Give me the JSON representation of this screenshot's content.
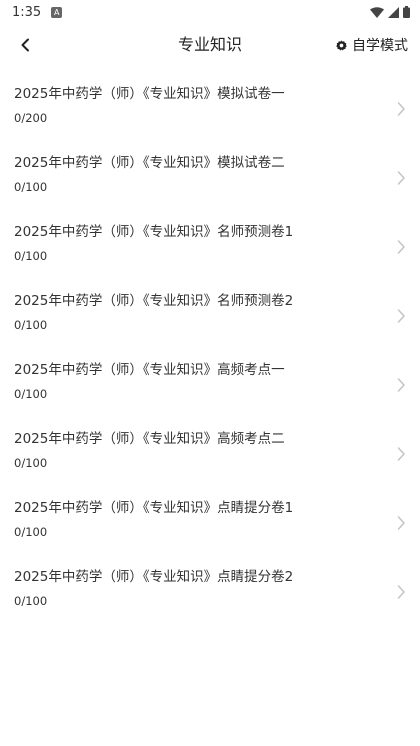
{
  "status_bar": {
    "time": "1:35",
    "notification_badge": "A"
  },
  "header": {
    "title": "专业知识",
    "mode_label": "自学模式",
    "back_icon": "chevron-left-icon",
    "mode_icon": "gear-icon"
  },
  "papers": [
    {
      "title": "2025年中药学（师）《专业知识》模拟试卷一",
      "progress": "0/200"
    },
    {
      "title": "2025年中药学（师）《专业知识》模拟试卷二",
      "progress": "0/100"
    },
    {
      "title": "2025年中药学（师）《专业知识》名师预测卷1",
      "progress": "0/100"
    },
    {
      "title": "2025年中药学（师）《专业知识》名师预测卷2",
      "progress": "0/100"
    },
    {
      "title": "2025年中药学（师）《专业知识》高频考点一",
      "progress": "0/100"
    },
    {
      "title": "2025年中药学（师）《专业知识》高频考点二",
      "progress": "0/100"
    },
    {
      "title": "2025年中药学（师）《专业知识》点睛提分卷1",
      "progress": "0/100"
    },
    {
      "title": "2025年中药学（师）《专业知识》点睛提分卷2",
      "progress": "0/100"
    }
  ],
  "colors": {
    "text": "#222222",
    "chevron": "#c4c4c4",
    "background": "#ffffff"
  }
}
